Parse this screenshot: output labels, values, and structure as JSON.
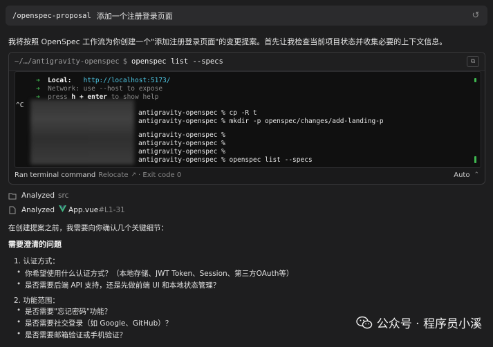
{
  "prompt": {
    "command": "/openspec-proposal",
    "request": "添加一个注册登录页面"
  },
  "intro": "我将按照 OpenSpec 工作流为你创建一个\"添加注册登录页面\"的变更提案。首先让我检查当前项目状态并收集必要的上下文信息。",
  "terminal": {
    "path": "~/…/antigravity-openspec",
    "prompt_symbol": "$",
    "command": "openspec list --specs",
    "lines": {
      "local_label": "Local:",
      "local_url": "http://localhost:5173/",
      "network": "Network: use --host to expose",
      "help_pre": "press ",
      "help_h": "h + enter",
      "help_post": " to show help",
      "ctrl_c": "^C",
      "l1": "antigravity-openspec % cp -R t",
      "l2": "antigravity-openspec % mkdir -p openspec/changes/add-landing-p",
      "l3": "antigravity-openspec %",
      "l4": "antigravity-openspec %",
      "l5": "antigravity-openspec %",
      "l6": "antigravity-openspec % openspec list --specs"
    },
    "footer": {
      "ran": "Ran terminal command",
      "relocate": "Relocate",
      "exit": "· Exit code 0",
      "auto": "Auto"
    }
  },
  "analyzed": [
    {
      "verb": "Analyzed",
      "object": "src"
    },
    {
      "verb": "Analyzed",
      "file": "App.vue",
      "range": "#L1-31"
    }
  ],
  "body": {
    "lead": "在创建提案之前，我需要向你确认几个关键细节：",
    "heading": "需要澄清的问题",
    "q1": "1.  认证方式：",
    "q1a": "你希望使用什么认证方式？（本地存储、JWT Token、Session、第三方OAuth等）",
    "q1b": "是否需要后端 API 支持，还是先做前端 UI 和本地状态管理？",
    "q2": "2.  功能范围：",
    "q2a": "是否需要\"忘记密码\"功能？",
    "q2b": "是否需要社交登录（如 Google、GitHub）？",
    "q2c": "是否需要邮箱验证或手机验证？"
  },
  "watermark": "公众号 · 程序员小溪",
  "colors": {
    "accent_green": "#3fb950",
    "url_cyan": "#4ec9e6",
    "vue_green": "#41b883"
  }
}
